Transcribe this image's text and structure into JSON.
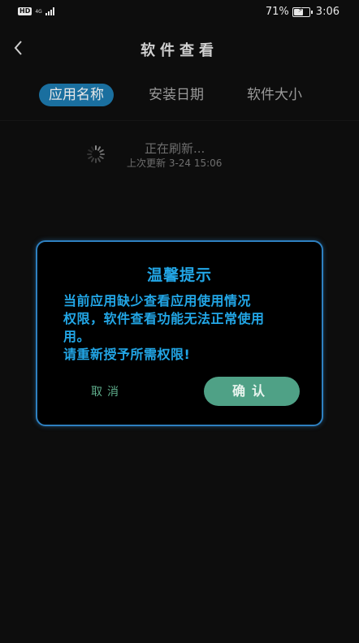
{
  "status_bar": {
    "hd_badge": "HD",
    "network_type": "4G",
    "battery_percent": "71%",
    "battery_level": 0.71,
    "time": "3:06"
  },
  "header": {
    "title": "软件查看",
    "back_icon": "chevron-left-icon"
  },
  "tabs": [
    {
      "label": "应用名称",
      "active": true
    },
    {
      "label": "安装日期",
      "active": false
    },
    {
      "label": "软件大小",
      "active": false
    }
  ],
  "refresh": {
    "status": "正在刷新...",
    "last_update": "上次更新 3-24 15:06"
  },
  "dialog": {
    "title": "温馨提示",
    "message_lines": [
      "当前应用缺少查看应用使用情况",
      "权限，软件查看功能无法正常使用",
      "用。",
      "请重新授予所需权限!"
    ],
    "cancel_label": "取消",
    "confirm_label": "确认"
  },
  "colors": {
    "accent_blue": "#22a6e6",
    "tab_active_bg": "#1a6f9f",
    "confirm_green": "#4fa186",
    "background": "#0d0d0d"
  }
}
